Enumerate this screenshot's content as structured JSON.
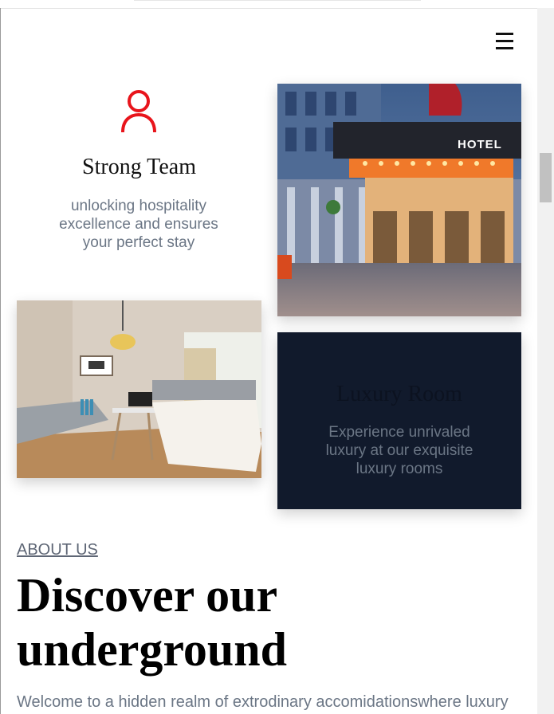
{
  "header": {
    "menu_icon": "hamburger-menu-icon"
  },
  "team": {
    "icon": "user-icon",
    "icon_color": "#e8141b",
    "title": "Strong Team",
    "description": "unlocking hospitality excellence and ensures your perfect stay"
  },
  "hotel_photo": {
    "sign_text": "HOTEL"
  },
  "luxury_card": {
    "title": "Luxury Room",
    "description": "Experience unrivaled luxury at our exquisite luxury rooms",
    "background": "#111a2c"
  },
  "about": {
    "label": "ABOUT US",
    "heading": "Discover our underground",
    "intro": "Welcome to a hidden realm of extrodinary accomidationswhere luxury"
  },
  "colors": {
    "text_muted": "#6b7685",
    "accent": "#e8141b"
  }
}
